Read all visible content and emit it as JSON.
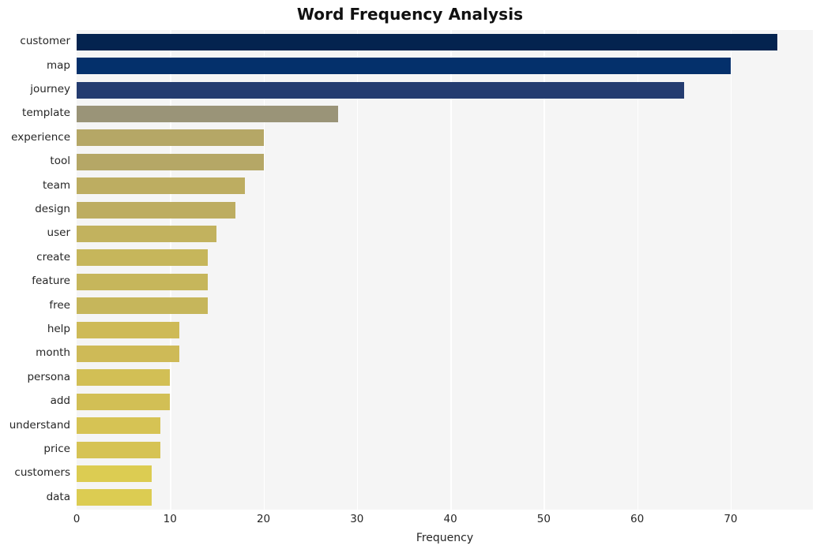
{
  "chart_data": {
    "type": "bar",
    "orientation": "horizontal",
    "title": "Word Frequency Analysis",
    "xlabel": "Frequency",
    "ylabel": "",
    "categories": [
      "customer",
      "map",
      "journey",
      "template",
      "experience",
      "tool",
      "team",
      "design",
      "user",
      "create",
      "feature",
      "free",
      "help",
      "month",
      "persona",
      "add",
      "understand",
      "price",
      "customers",
      "data"
    ],
    "values": [
      75,
      70,
      65,
      28,
      20,
      20,
      18,
      17,
      15,
      14,
      14,
      14,
      11,
      11,
      10,
      10,
      9,
      9,
      8,
      8
    ],
    "bar_colors": [
      "#04234f",
      "#04306b",
      "#243c70",
      "#9a9478",
      "#b5a766",
      "#b5a766",
      "#bdad61",
      "#bdad61",
      "#c2b25e",
      "#c6b65b",
      "#c6b65b",
      "#c6b65b",
      "#ceba57",
      "#ceba57",
      "#d2bf55",
      "#d2bf55",
      "#d6c354",
      "#d6c354",
      "#dccc52",
      "#dccc52"
    ],
    "xlim": [
      0,
      78.8
    ],
    "xticks": [
      0,
      10,
      20,
      30,
      40,
      50,
      60,
      70
    ],
    "xtick_labels": [
      "0",
      "10",
      "20",
      "30",
      "40",
      "50",
      "60",
      "70"
    ],
    "grid": "vertical-white-on-gray",
    "legend": "none",
    "plot_background": "#f5f5f5",
    "figure_background": "#ffffff"
  }
}
